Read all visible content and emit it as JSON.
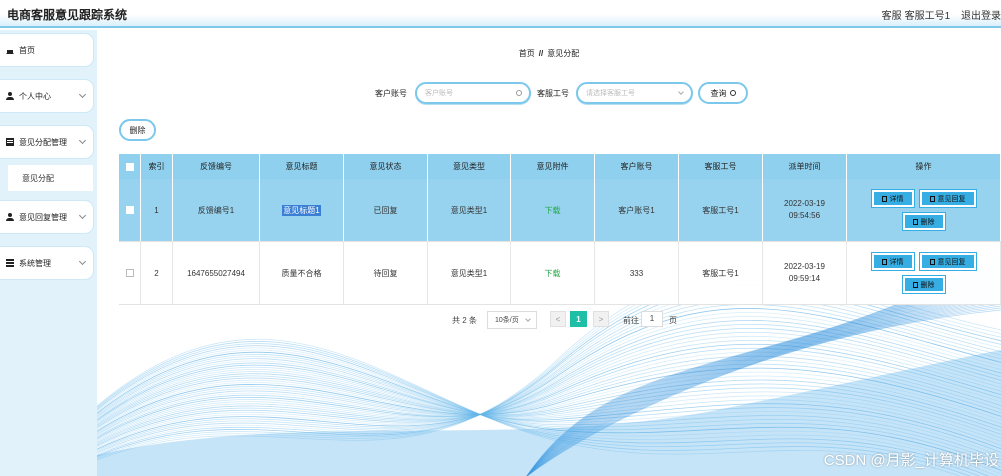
{
  "app": {
    "title": "电商客服意见跟踪系统"
  },
  "header": {
    "role": "客服",
    "username": "客服工号1",
    "logout": "退出登录"
  },
  "sidebar": {
    "items": [
      {
        "label": "首页"
      },
      {
        "label": "个人中心"
      },
      {
        "label": "意见分配管理"
      },
      {
        "label": "意见分配"
      },
      {
        "label": "意见回复管理"
      },
      {
        "label": "系统管理"
      }
    ]
  },
  "breadcrumb": {
    "home": "首页",
    "separator": "//",
    "current": "意见分配"
  },
  "search": {
    "customer_label": "客户账号",
    "customer_placeholder": "客户账号",
    "staff_label": "客服工号",
    "staff_placeholder": "请选择客服工号",
    "query_button": "查询"
  },
  "toolbar": {
    "delete_label": "删除"
  },
  "table": {
    "columns": [
      "",
      "索引",
      "反馈编号",
      "意见标题",
      "意见状态",
      "意见类型",
      "意见附件",
      "客户账号",
      "客服工号",
      "派单时间",
      "操作"
    ],
    "rows": [
      {
        "index": "1",
        "feedback_no": "反馈编号1",
        "title": "意见标题1",
        "status": "已回复",
        "type": "意见类型1",
        "attachment": "下载",
        "customer": "客户账号1",
        "staff": "客服工号1",
        "time": "2022-03-19 09:54:56",
        "selected": true
      },
      {
        "index": "2",
        "feedback_no": "1647655027494",
        "title": "质量不合格",
        "status": "待回复",
        "type": "意见类型1",
        "attachment": "下载",
        "customer": "333",
        "staff": "客服工号1",
        "time": "2022-03-19 09:59:14",
        "selected": false
      }
    ],
    "actions": {
      "detail": "详情",
      "reply": "意见回复",
      "delete": "删除"
    }
  },
  "pagination": {
    "total": "共 2 条",
    "page_size": "10条/页",
    "prev": "<",
    "next": ">",
    "current_page": "1",
    "goto_label": "前往",
    "goto_value": "1",
    "page_suffix": "页"
  },
  "watermark": "CSDN @月影_计算机毕设",
  "colors": {
    "accent": "#36aee3",
    "header_row": "#8fd0ee",
    "selected_row": "#97d2ee",
    "pager_active": "#1ebfa6",
    "attachment_link": "#25a845"
  }
}
